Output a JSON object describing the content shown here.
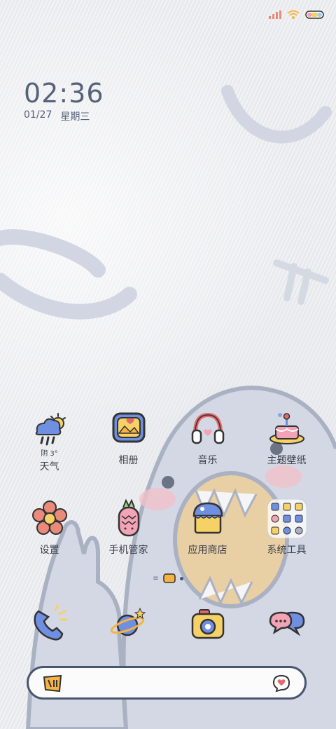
{
  "clock": {
    "time": "02:36",
    "date": "01/27",
    "weekday": "星期三"
  },
  "weather": {
    "condition": "阴",
    "temperature": "3°"
  },
  "row1": [
    {
      "label": "天气",
      "icon": "weather-icon"
    },
    {
      "label": "相册",
      "icon": "gallery-icon"
    },
    {
      "label": "音乐",
      "icon": "headphones-icon"
    },
    {
      "label": "主题壁纸",
      "icon": "cake-icon"
    }
  ],
  "row2": [
    {
      "label": "设置",
      "icon": "flower-icon"
    },
    {
      "label": "手机管家",
      "icon": "pineapple-icon"
    },
    {
      "label": "应用商店",
      "icon": "store-cupcake-icon"
    },
    {
      "label": "系统工具",
      "icon": "folder-icon"
    }
  ],
  "dock": [
    {
      "icon": "phone-icon"
    },
    {
      "icon": "planet-icon"
    },
    {
      "icon": "camera-icon"
    },
    {
      "icon": "message-icon"
    }
  ],
  "colors": {
    "ink": "#4a5670",
    "blue": "#6f8fe0",
    "yellow": "#f6d165",
    "pink": "#f2a3b6",
    "red": "#e26a6a"
  }
}
